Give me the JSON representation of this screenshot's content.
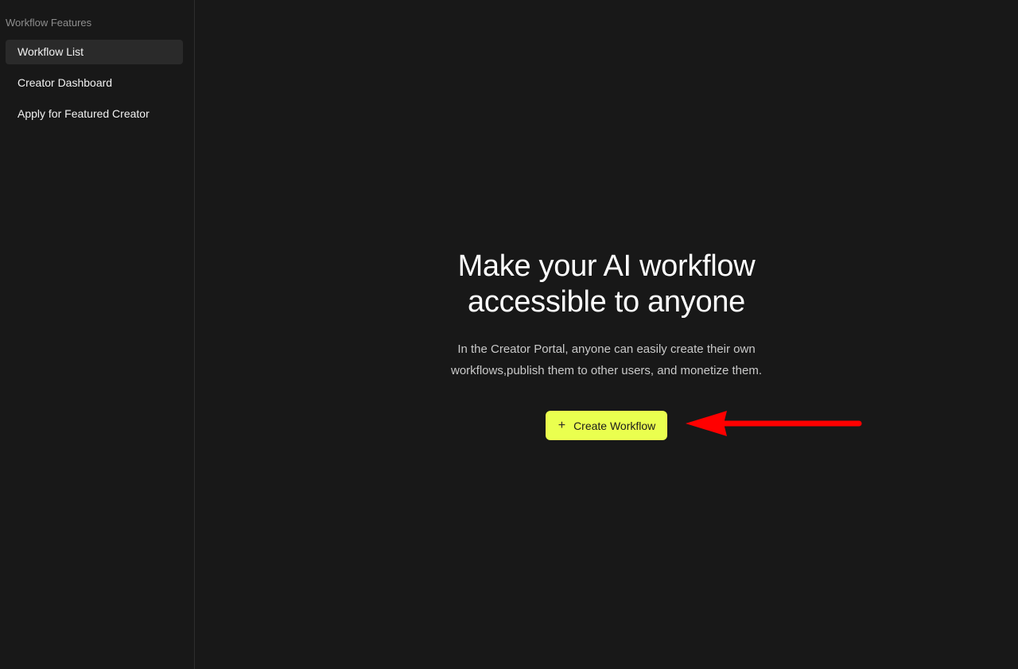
{
  "sidebar": {
    "heading": "Workflow Features",
    "items": [
      {
        "label": "Workflow List",
        "active": true
      },
      {
        "label": "Creator Dashboard",
        "active": false
      },
      {
        "label": "Apply for Featured Creator",
        "active": false
      }
    ]
  },
  "hero": {
    "title": "Make your AI workflow accessible to anyone",
    "description": "In the Creator Portal, anyone can easily create their own workflows,publish them to other users, and monetize them.",
    "button_icon": "+",
    "button_label": "Create Workflow"
  },
  "colors": {
    "background": "#181818",
    "accent": "#eaff4f",
    "annotation": "#ff0000"
  },
  "icons": {
    "button": "plus-icon",
    "annotation": "red-arrow-icon"
  }
}
